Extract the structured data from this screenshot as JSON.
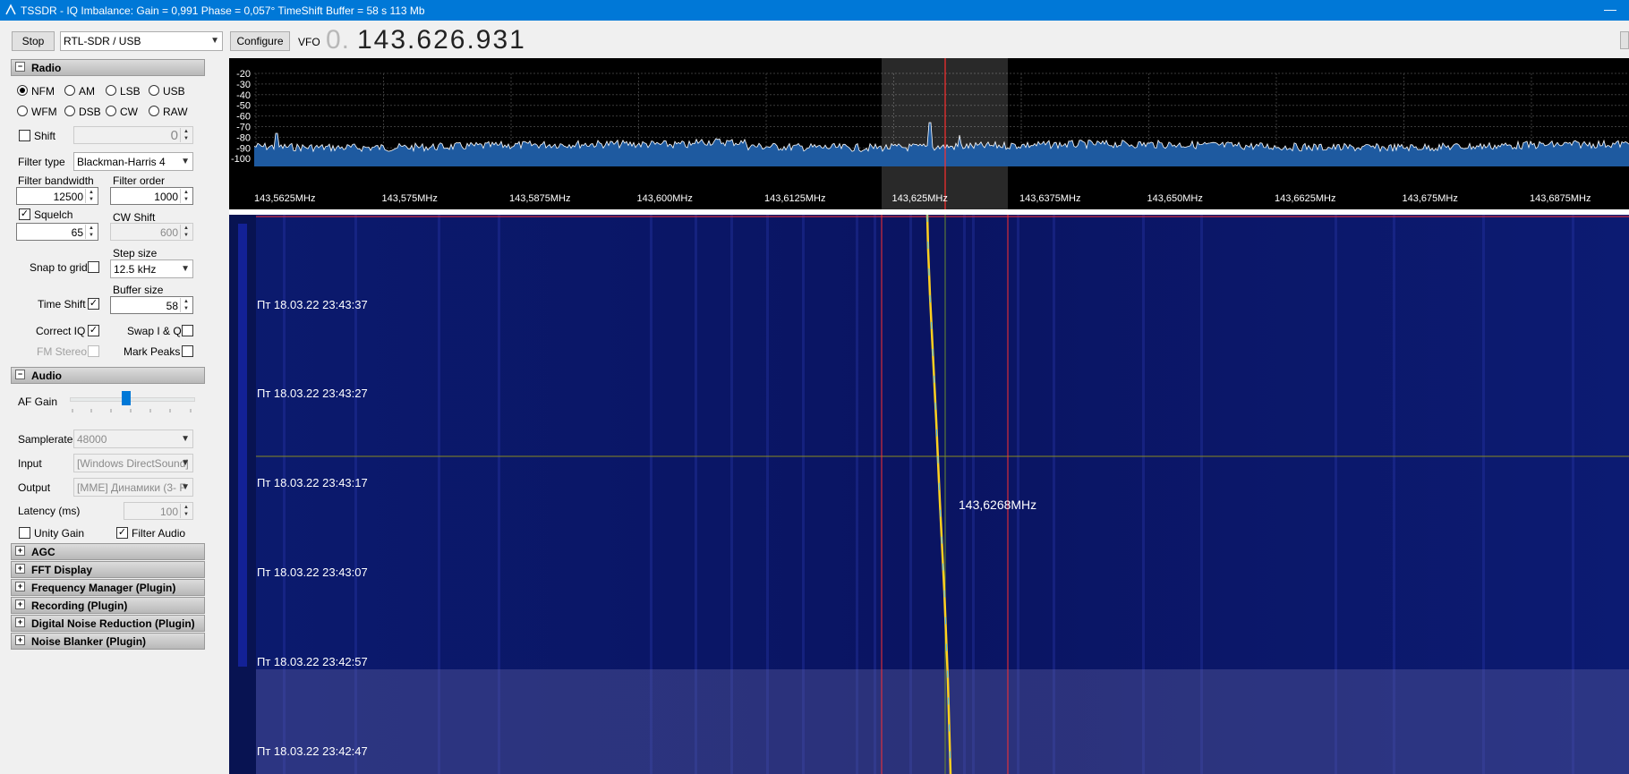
{
  "window": {
    "title": "TSSDR - IQ Imbalance: Gain = 0,991 Phase = 0,057° TimeShift Buffer = 58 s  113 Mb"
  },
  "toolbar": {
    "stop_label": "Stop",
    "device": "RTL-SDR / USB",
    "configure_label": "Configure",
    "vfo_label": "VFO",
    "vfo_prefix": "0.",
    "vfo_value": "143.626.931"
  },
  "radio": {
    "header": "Radio",
    "modes": [
      {
        "label": "NFM",
        "selected": true
      },
      {
        "label": "AM",
        "selected": false
      },
      {
        "label": "LSB",
        "selected": false
      },
      {
        "label": "USB",
        "selected": false
      },
      {
        "label": "WFM",
        "selected": false
      },
      {
        "label": "DSB",
        "selected": false
      },
      {
        "label": "CW",
        "selected": false
      },
      {
        "label": "RAW",
        "selected": false
      }
    ],
    "shift_label": "Shift",
    "shift_value": "0",
    "filter_type_label": "Filter type",
    "filter_type_value": "Blackman-Harris 4",
    "filter_bandwidth_label": "Filter bandwidth",
    "filter_bandwidth_value": "12500",
    "filter_order_label": "Filter order",
    "filter_order_value": "1000",
    "squelch_label": "Squelch",
    "squelch_value": "65",
    "cw_shift_label": "CW Shift",
    "cw_shift_value": "600",
    "snap_label": "Snap to grid",
    "step_size_label": "Step size",
    "step_size_value": "12.5 kHz",
    "time_shift_label": "Time Shift",
    "buffer_size_label": "Buffer size",
    "buffer_size_value": "58",
    "correct_iq_label": "Correct IQ",
    "swap_iq_label": "Swap I & Q",
    "fm_stereo_label": "FM Stereo",
    "mark_peaks_label": "Mark Peaks"
  },
  "audio": {
    "header": "Audio",
    "af_gain_label": "AF Gain",
    "af_gain_level": 0.45,
    "samplerate_label": "Samplerate",
    "samplerate_value": "48000",
    "input_label": "Input",
    "input_value": "[Windows DirectSound]",
    "output_label": "Output",
    "output_value": "[MME] Динамики (3- F",
    "latency_label": "Latency (ms)",
    "latency_value": "100",
    "unity_gain_label": "Unity Gain",
    "filter_audio_label": "Filter Audio"
  },
  "collapsed_sections": [
    "AGC",
    "FFT Display",
    "Frequency Manager (Plugin)",
    "Recording (Plugin)",
    "Digital Noise Reduction (Plugin)",
    "Noise Blanker (Plugin)"
  ],
  "spectrum": {
    "db_labels": [
      "-20",
      "-30",
      "-40",
      "-50",
      "-60",
      "-70",
      "-80",
      "-90",
      "-100"
    ],
    "freq_labels": [
      "143,5625MHz",
      "143,575MHz",
      "143,5875MHz",
      "143,600MHz",
      "143,6125MHz",
      "143,625MHz",
      "143,6375MHz",
      "143,650MHz",
      "143,6625MHz",
      "143,675MHz",
      "143,6875MHz"
    ]
  },
  "waterfall": {
    "timestamps": [
      "Пт 18.03.22 23:43:37",
      "Пт 18.03.22 23:43:27",
      "Пт 18.03.22 23:43:17",
      "Пт 18.03.22 23:43:07",
      "Пт 18.03.22 23:42:57",
      "Пт 18.03.22 23:42:47"
    ],
    "cursor_freq": "143,6268MHz"
  },
  "colors": {
    "accent": "#0078d7",
    "waterfall_bg": "#0a1565",
    "spectrum_fill": "#1e5aa0",
    "marker": "#ff3030"
  }
}
